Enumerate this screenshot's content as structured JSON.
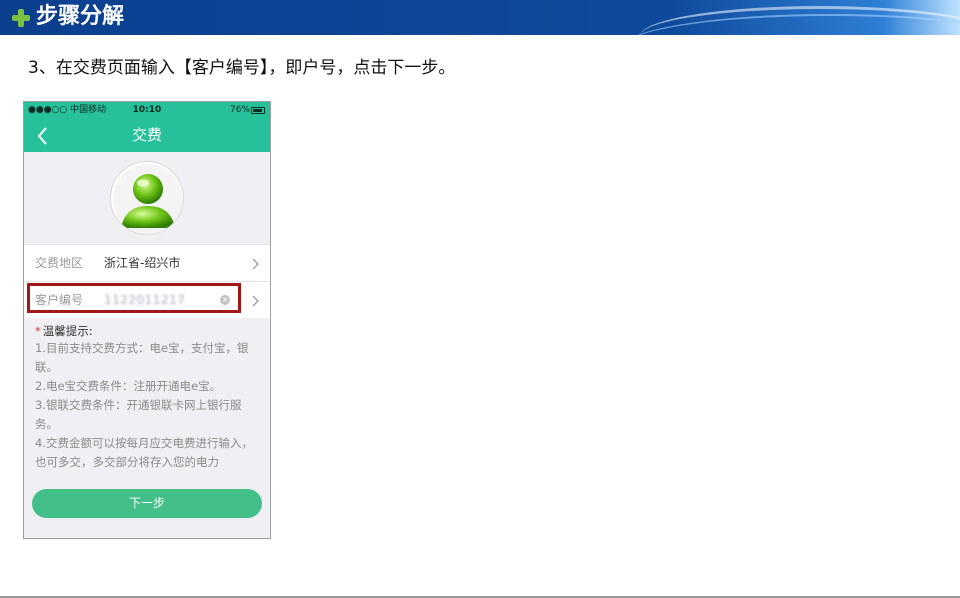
{
  "banner": {
    "title": "步骤分解"
  },
  "instruction": "3、在交费页面输入【客户编号】，即户号，点击下一步。",
  "phone": {
    "status": {
      "carrier": "●●●○○ 中国移动",
      "time": "10:10",
      "battery": "76%"
    },
    "nav": {
      "title": "交费"
    },
    "region_row": {
      "label": "交费地区",
      "value": "浙江省-绍兴市"
    },
    "customer_row": {
      "label": "客户编号",
      "value": "1122011217"
    },
    "tips": {
      "title": "温馨提示:",
      "star": "*",
      "lines": [
        "1.目前支持交费方式：电e宝，支付宝，银联。",
        "2.电e宝交费条件：注册开通电e宝。",
        "3.银联交费条件：开通银联卡网上银行服务。",
        "4.交费金额可以按每月应交电费进行输入，也可多交，多交部分将存入您的电力"
      ]
    },
    "next_button": {
      "label": "下一步"
    }
  },
  "colors": {
    "nav_green": "#26c09b",
    "button_green": "#43bf8a",
    "highlight_red": "#a11616",
    "banner_blue": "#0c3f8e"
  }
}
